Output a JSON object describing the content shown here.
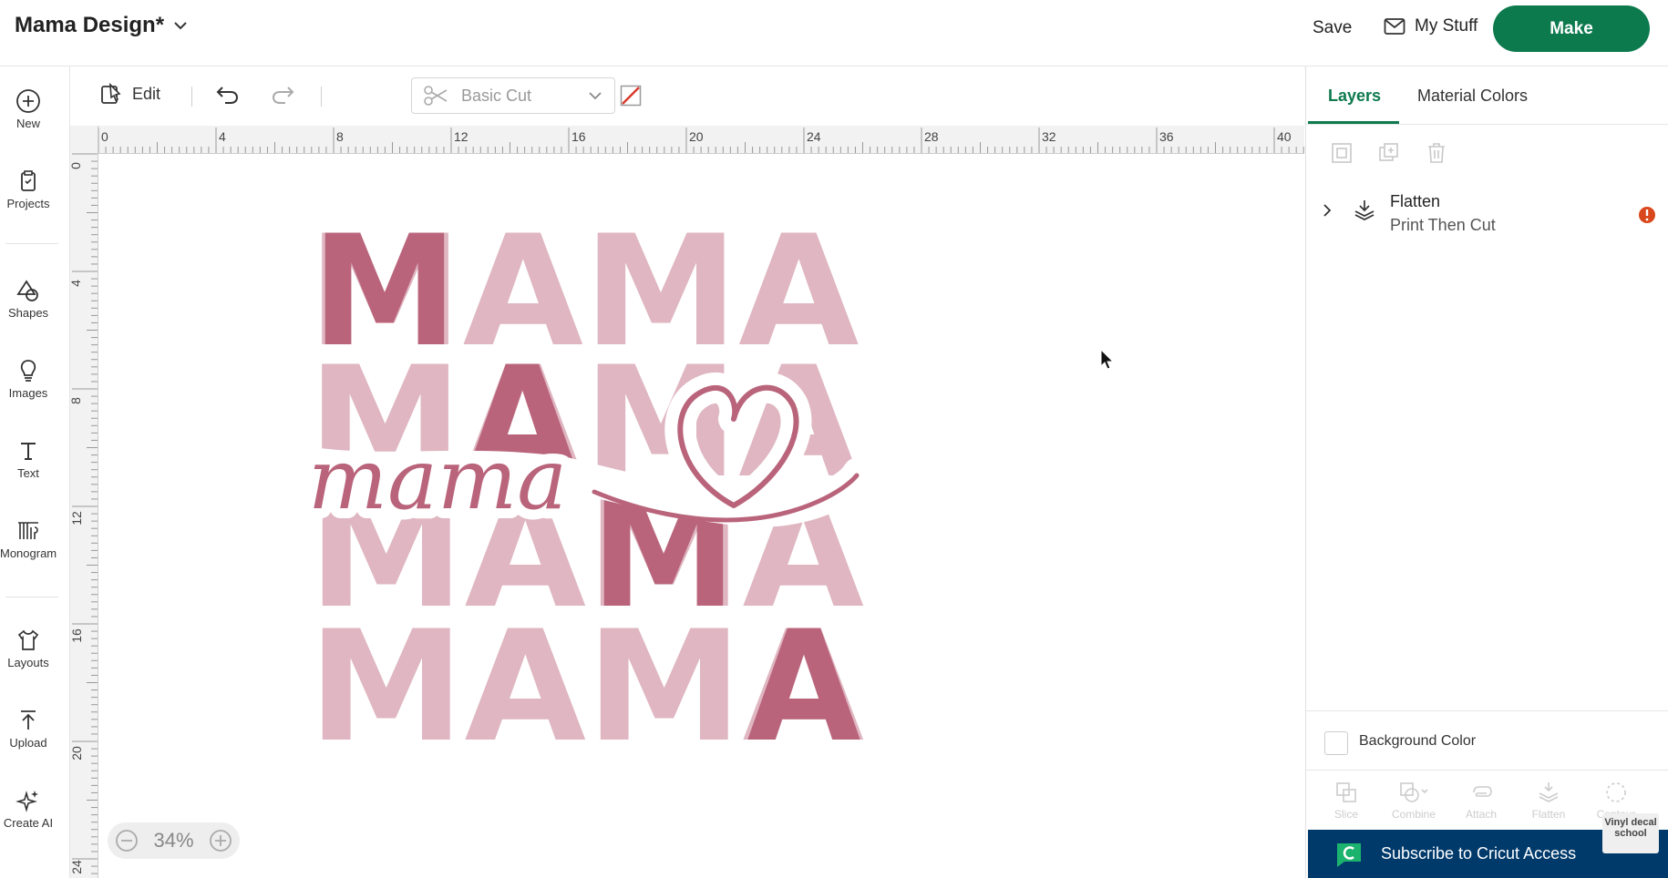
{
  "header": {
    "project_title": "Mama Design*",
    "save_label": "Save",
    "my_stuff_label": "My Stuff",
    "make_label": "Make"
  },
  "sidebar": {
    "items": [
      {
        "label": "New",
        "icon": "plus-circle-icon"
      },
      {
        "label": "Projects",
        "icon": "clipboard-icon"
      },
      {
        "label": "Shapes",
        "icon": "shapes-icon"
      },
      {
        "label": "Images",
        "icon": "lightbulb-icon"
      },
      {
        "label": "Text",
        "icon": "text-icon"
      },
      {
        "label": "Monogram",
        "icon": "monogram-icon"
      },
      {
        "label": "Layouts",
        "icon": "shirt-icon"
      },
      {
        "label": "Upload",
        "icon": "upload-icon"
      },
      {
        "label": "Create AI",
        "icon": "sparkle-icon"
      }
    ]
  },
  "toolbar": {
    "edit_label": "Edit",
    "operation_value": "Basic Cut"
  },
  "rulers": {
    "horizontal": [
      "0",
      "4",
      "8",
      "12",
      "16",
      "20",
      "24",
      "28",
      "32",
      "36",
      "40"
    ],
    "vertical": [
      "0",
      "4",
      "8",
      "12",
      "16",
      "20",
      "24"
    ]
  },
  "canvas": {
    "design_words": [
      "MAMA",
      "MAMA",
      "MAMA",
      "MAMA"
    ],
    "script_word": "mama",
    "colors": {
      "light_pink": "#dfb6c1",
      "dark_rose": "#b9647b"
    },
    "zoom": "34%"
  },
  "right_panel": {
    "tabs": [
      "Layers",
      "Material Colors"
    ],
    "layer": {
      "name": "Flatten",
      "subtitle": "Print Then Cut",
      "warning": true
    },
    "background_color_label": "Background Color",
    "bottom_tools": [
      "Slice",
      "Combine",
      "Attach",
      "Flatten",
      "Contour"
    ],
    "subscribe_label": "Subscribe to Cricut Access",
    "badge_text": "Vinyl decal school"
  },
  "colors": {
    "accent": "#0d7a4e",
    "subscribe_bg": "#003a6b",
    "warning": "#d9481c"
  }
}
